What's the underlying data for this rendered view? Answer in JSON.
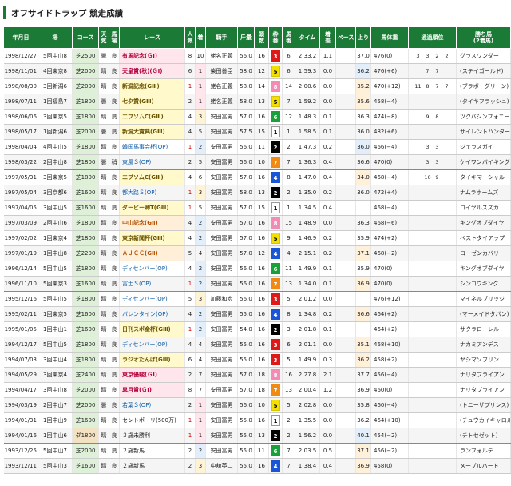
{
  "page": {
    "title": "オフサイドトラップ 競走成績"
  },
  "colors": {
    "header": "#1b7a35"
  },
  "columns": [
    "年月日",
    "場",
    "コース",
    "天気",
    "馬場",
    "レース",
    "人気",
    "着",
    "騎手",
    "斤量",
    "頭数",
    "枠番",
    "馬番",
    "タイム",
    "着差",
    "ペース",
    "上り",
    "馬体重",
    "通過順位",
    "勝ち馬(2着馬)"
  ],
  "rows": [
    {
      "date": "1998/12/27",
      "venue": "5回中山8",
      "course": "芝2500",
      "weather": "曇",
      "track": "良",
      "race": "有馬記念(ＧⅠ)",
      "grade": "g1",
      "pop": "8",
      "finish": "10",
      "jockey": "蛯名正義",
      "weight": "56.0",
      "field": "16",
      "waku": "3",
      "uma": "6",
      "time": "2:33.2",
      "margin": "1.1",
      "pace": "",
      "up": "37.0",
      "up_hl": "",
      "bw": "476(0)",
      "corners": [
        "3",
        "3",
        "2",
        "2"
      ],
      "winner": "グラスワンダー"
    },
    {
      "date": "1998/11/01",
      "venue": "4回東京8",
      "course": "芝2000",
      "weather": "晴",
      "track": "良",
      "race": "天皇賞(秋)(ＧⅠ)",
      "grade": "g1",
      "pop": "6",
      "finish": "1",
      "jockey": "柴田善臣",
      "weight": "58.0",
      "field": "12",
      "waku": "5",
      "uma": "6",
      "time": "1:59.3",
      "margin": "0.0",
      "pace": "",
      "up": "36.2",
      "up_hl": "b",
      "bw": "476(+6)",
      "corners": [
        "",
        "7",
        "7",
        ""
      ],
      "winner": "(ステイゴールド)"
    },
    {
      "date": "1998/08/30",
      "venue": "3回新潟6",
      "course": "芝2000",
      "weather": "晴",
      "track": "良",
      "race": "新潟記念(GⅢ)",
      "grade": "g3",
      "pop": "1",
      "finish": "1",
      "jockey": "蛯名正義",
      "weight": "58.0",
      "field": "14",
      "waku": "8",
      "uma": "14",
      "time": "2:00.6",
      "margin": "0.0",
      "pace": "",
      "up": "35.2",
      "up_hl": "a",
      "bw": "470(+12)",
      "corners": [
        "11",
        "8",
        "7",
        "7"
      ],
      "winner": "(ブラボーグリーン)"
    },
    {
      "date": "1998/07/11",
      "venue": "1回福島7",
      "course": "芝1800",
      "weather": "曇",
      "track": "良",
      "race": "七夕賞(GⅢ)",
      "grade": "g3",
      "pop": "2",
      "finish": "1",
      "jockey": "蛯名正義",
      "weight": "58.0",
      "field": "13",
      "waku": "5",
      "uma": "7",
      "time": "1:59.2",
      "margin": "0.0",
      "pace": "",
      "up": "35.6",
      "up_hl": "a",
      "bw": "458(−4)",
      "corners": [
        "",
        "",
        "",
        ""
      ],
      "winner": "(タイキフラッシュ)"
    },
    {
      "date": "1998/06/06",
      "venue": "3回東京5",
      "course": "芝1800",
      "weather": "晴",
      "track": "良",
      "race": "エプソムC(GⅢ)",
      "grade": "g3",
      "pop": "4",
      "finish": "3",
      "jockey": "安田富男",
      "weight": "57.0",
      "field": "16",
      "waku": "6",
      "uma": "12",
      "time": "1:48.3",
      "margin": "0.1",
      "pace": "",
      "up": "36.3",
      "up_hl": "",
      "bw": "474(−8)",
      "corners": [
        "",
        "9",
        "8",
        ""
      ],
      "winner": "ツクバシンフォニー"
    },
    {
      "date": "1998/05/17",
      "venue": "1回新潟6",
      "course": "芝2000",
      "weather": "曇",
      "track": "良",
      "race": "新潟大賞典(GⅢ)",
      "grade": "g3",
      "pop": "4",
      "finish": "5",
      "jockey": "安田富男",
      "weight": "57.5",
      "field": "15",
      "waku": "1",
      "uma": "1",
      "time": "1:58.5",
      "margin": "0.1",
      "pace": "",
      "up": "36.0",
      "up_hl": "",
      "bw": "482(+6)",
      "corners": [
        "",
        "",
        "",
        ""
      ],
      "winner": "サイレントハンター"
    },
    {
      "date": "1998/04/04",
      "venue": "4回中山5",
      "course": "芝1800",
      "weather": "晴",
      "track": "良",
      "race": "韓国馬事会杯(OP)",
      "grade": "op",
      "pop": "1",
      "finish": "2",
      "jockey": "安田富男",
      "weight": "56.0",
      "field": "11",
      "waku": "2",
      "uma": "2",
      "time": "1:47.3",
      "margin": "0.2",
      "pace": "",
      "up": "36.0",
      "up_hl": "b",
      "bw": "466(−4)",
      "corners": [
        "",
        "3",
        "3",
        ""
      ],
      "winner": "ジェラスガイ"
    },
    {
      "date": "1998/03/22",
      "venue": "2回中山8",
      "course": "芝1800",
      "weather": "曇",
      "track": "稍",
      "race": "東風Ｓ(OP)",
      "grade": "op",
      "pop": "2",
      "finish": "5",
      "jockey": "安田富男",
      "weight": "56.0",
      "field": "10",
      "waku": "7",
      "uma": "7",
      "time": "1:36.3",
      "margin": "0.4",
      "pace": "",
      "up": "36.6",
      "up_hl": "",
      "bw": "470(0)",
      "corners": [
        "",
        "3",
        "3",
        ""
      ],
      "winner": "ケイワンバイキング"
    },
    {
      "date": "1997/05/31",
      "venue": "3回東京5",
      "course": "芝1800",
      "weather": "晴",
      "track": "良",
      "race": "エプソムC(GⅢ)",
      "grade": "g3",
      "pop": "4",
      "finish": "6",
      "jockey": "安田富男",
      "weight": "57.0",
      "field": "16",
      "waku": "4",
      "uma": "8",
      "time": "1:47.0",
      "margin": "0.4",
      "pace": "",
      "up": "34.0",
      "up_hl": "a",
      "bw": "468(−4)",
      "corners": [
        "",
        "10",
        "9",
        ""
      ],
      "winner": "タイキマーシャル"
    },
    {
      "date": "1997/05/04",
      "venue": "3回京都6",
      "course": "芝1600",
      "weather": "晴",
      "track": "良",
      "race": "都大路Ｓ(OP)",
      "grade": "op",
      "pop": "1",
      "finish": "3",
      "jockey": "安田富男",
      "weight": "58.0",
      "field": "13",
      "waku": "2",
      "uma": "2",
      "time": "1:35.0",
      "margin": "0.2",
      "pace": "",
      "up": "36.0",
      "up_hl": "",
      "bw": "472(+4)",
      "corners": [
        "",
        "",
        "",
        ""
      ],
      "winner": "ナムラホームズ"
    },
    {
      "date": "1997/04/05",
      "venue": "3回中山5",
      "course": "芝1600",
      "weather": "晴",
      "track": "良",
      "race": "ダービー卿T(GⅢ)",
      "grade": "g3",
      "pop": "1",
      "finish": "5",
      "jockey": "安田富男",
      "weight": "57.0",
      "field": "15",
      "waku": "1",
      "uma": "1",
      "time": "1:34.5",
      "margin": "0.4",
      "pace": "",
      "up": "",
      "up_hl": "",
      "bw": "468(−4)",
      "corners": [
        "",
        "",
        "",
        ""
      ],
      "winner": "ロイヤルスズカ"
    },
    {
      "date": "1997/03/09",
      "venue": "2回中山6",
      "course": "芝1800",
      "weather": "晴",
      "track": "良",
      "race": "中山記念(GⅡ)",
      "grade": "g2",
      "pop": "4",
      "finish": "2",
      "jockey": "安田富男",
      "weight": "57.0",
      "field": "16",
      "waku": "8",
      "uma": "15",
      "time": "1:48.9",
      "margin": "0.0",
      "pace": "",
      "up": "36.3",
      "up_hl": "",
      "bw": "468(−6)",
      "corners": [
        "",
        "",
        "",
        ""
      ],
      "winner": "キングオブダイヤ"
    },
    {
      "date": "1997/02/02",
      "venue": "1回東京4",
      "course": "芝1800",
      "weather": "晴",
      "track": "良",
      "race": "東京新聞杯(GⅢ)",
      "grade": "g3",
      "pop": "4",
      "finish": "2",
      "jockey": "安田富男",
      "weight": "57.0",
      "field": "16",
      "waku": "5",
      "uma": "9",
      "time": "1:46.9",
      "margin": "0.2",
      "pace": "",
      "up": "35.9",
      "up_hl": "",
      "bw": "474(+2)",
      "corners": [
        "",
        "",
        "",
        ""
      ],
      "winner": "ベストタイアップ"
    },
    {
      "date": "1997/01/19",
      "venue": "1回中山8",
      "course": "芝2200",
      "weather": "晴",
      "track": "良",
      "race": "ＡＪＣＣ(GⅡ)",
      "grade": "g2",
      "pop": "5",
      "finish": "4",
      "jockey": "安田富男",
      "weight": "57.0",
      "field": "12",
      "waku": "4",
      "uma": "4",
      "time": "2:15.1",
      "margin": "0.2",
      "pace": "",
      "up": "37.1",
      "up_hl": "a",
      "bw": "468(−2)",
      "corners": [
        "",
        "",
        "",
        ""
      ],
      "winner": "ローゼンカバリー"
    },
    {
      "date": "1996/12/14",
      "venue": "5回中山5",
      "course": "芝1800",
      "weather": "晴",
      "track": "良",
      "race": "ディセンバー(OP)",
      "grade": "op",
      "pop": "4",
      "finish": "2",
      "jockey": "安田富男",
      "weight": "56.0",
      "field": "16",
      "waku": "6",
      "uma": "11",
      "time": "1:49.9",
      "margin": "0.1",
      "pace": "",
      "up": "35.9",
      "up_hl": "",
      "bw": "470(0)",
      "corners": [
        "",
        "",
        "",
        ""
      ],
      "winner": "キングオブダイヤ"
    },
    {
      "date": "1996/11/10",
      "venue": "5回東京3",
      "course": "芝1600",
      "weather": "晴",
      "track": "良",
      "race": "富士Ｓ(OP)",
      "grade": "op",
      "pop": "1",
      "finish": "2",
      "jockey": "安田富男",
      "weight": "56.0",
      "field": "16",
      "waku": "7",
      "uma": "13",
      "time": "1:34.0",
      "margin": "0.1",
      "pace": "",
      "up": "36.9",
      "up_hl": "a",
      "bw": "470(0)",
      "corners": [
        "",
        "",
        "",
        ""
      ],
      "winner": "シンコウキング"
    },
    {
      "date": "1995/12/16",
      "venue": "5回中山5",
      "course": "芝1800",
      "weather": "晴",
      "track": "良",
      "race": "ディセンバー(OP)",
      "grade": "op",
      "pop": "5",
      "finish": "3",
      "jockey": "加藤和宏",
      "weight": "56.0",
      "field": "16",
      "waku": "3",
      "uma": "5",
      "time": "2:01.2",
      "margin": "0.0",
      "pace": "",
      "up": "",
      "up_hl": "",
      "bw": "476(+12)",
      "corners": [
        "",
        "",
        "",
        ""
      ],
      "winner": "マイネルブリッジ"
    },
    {
      "date": "1995/02/11",
      "venue": "1回東京5",
      "course": "芝1600",
      "weather": "晴",
      "track": "良",
      "race": "バレンタイン(OP)",
      "grade": "op",
      "pop": "4",
      "finish": "2",
      "jockey": "安田富男",
      "weight": "55.0",
      "field": "16",
      "waku": "4",
      "uma": "8",
      "time": "1:34.8",
      "margin": "0.2",
      "pace": "",
      "up": "36.6",
      "up_hl": "a",
      "bw": "464(+2)",
      "corners": [
        "",
        "",
        "",
        ""
      ],
      "winner": "(マーメイドタバン)"
    },
    {
      "date": "1995/01/05",
      "venue": "1回中山1",
      "course": "芝1600",
      "weather": "晴",
      "track": "良",
      "race": "日刊スポ金杯(GⅢ)",
      "grade": "g3",
      "pop": "1",
      "finish": "2",
      "jockey": "安田富男",
      "weight": "54.0",
      "field": "16",
      "waku": "2",
      "uma": "3",
      "time": "2:01.8",
      "margin": "0.1",
      "pace": "",
      "up": "",
      "up_hl": "",
      "bw": "464(+2)",
      "corners": [
        "",
        "",
        "",
        ""
      ],
      "winner": "サクラローレル"
    },
    {
      "date": "1994/12/17",
      "venue": "5回中山5",
      "course": "芝1800",
      "weather": "晴",
      "track": "良",
      "race": "ディセンバー(OP)",
      "grade": "op",
      "pop": "4",
      "finish": "4",
      "jockey": "安田富男",
      "weight": "55.0",
      "field": "16",
      "waku": "3",
      "uma": "6",
      "time": "2:01.1",
      "margin": "0.0",
      "pace": "",
      "up": "35.1",
      "up_hl": "a",
      "bw": "468(+10)",
      "corners": [
        "",
        "",
        "",
        ""
      ],
      "winner": "ナカミアンデス"
    },
    {
      "date": "1994/07/03",
      "venue": "3回中山4",
      "course": "芝1800",
      "weather": "晴",
      "track": "良",
      "race": "ラジオたんぱ(GⅢ)",
      "grade": "g3",
      "pop": "6",
      "finish": "4",
      "jockey": "安田富男",
      "weight": "55.0",
      "field": "16",
      "waku": "3",
      "uma": "5",
      "time": "1:49.9",
      "margin": "0.3",
      "pace": "",
      "up": "36.2",
      "up_hl": "a",
      "bw": "458(+2)",
      "corners": [
        "",
        "",
        "",
        ""
      ],
      "winner": "ヤシマソブリン"
    },
    {
      "date": "1994/05/29",
      "venue": "3回東京4",
      "course": "芝2400",
      "weather": "晴",
      "track": "良",
      "race": "東京優駿(ＧⅠ)",
      "grade": "g1",
      "pop": "2",
      "finish": "7",
      "jockey": "安田富男",
      "weight": "57.0",
      "field": "18",
      "waku": "8",
      "uma": "16",
      "time": "2:27.8",
      "margin": "2.1",
      "pace": "",
      "up": "37.7",
      "up_hl": "",
      "bw": "456(−4)",
      "corners": [
        "",
        "",
        "",
        ""
      ],
      "winner": "ナリタブライアン"
    },
    {
      "date": "1994/04/17",
      "venue": "3回中山8",
      "course": "芝2000",
      "weather": "晴",
      "track": "良",
      "race": "皐月賞(ＧⅠ)",
      "grade": "g1",
      "pop": "8",
      "finish": "7",
      "jockey": "安田富男",
      "weight": "57.0",
      "field": "18",
      "waku": "7",
      "uma": "13",
      "time": "2:00.4",
      "margin": "1.2",
      "pace": "",
      "up": "36.9",
      "up_hl": "",
      "bw": "460(0)",
      "corners": [
        "",
        "",
        "",
        ""
      ],
      "winner": "ナリタブライアン"
    },
    {
      "date": "1994/03/19",
      "venue": "2回中山7",
      "course": "芝2000",
      "weather": "曇",
      "track": "良",
      "race": "若葉Ｓ(OP)",
      "grade": "op",
      "pop": "2",
      "finish": "1",
      "jockey": "安田富男",
      "weight": "56.0",
      "field": "10",
      "waku": "5",
      "uma": "5",
      "time": "2:02.8",
      "margin": "0.0",
      "pace": "",
      "up": "35.8",
      "up_hl": "",
      "bw": "460(−4)",
      "corners": [
        "",
        "",
        "",
        ""
      ],
      "winner": "(トニーザプリンス)"
    },
    {
      "date": "1994/01/31",
      "venue": "1回中山9",
      "course": "芝1600",
      "weather": "晴",
      "track": "良",
      "race": "セントポーリ(500万)",
      "grade": "",
      "pop": "1",
      "finish": "1",
      "jockey": "安田富男",
      "weight": "55.0",
      "field": "16",
      "waku": "1",
      "uma": "2",
      "time": "1:35.5",
      "margin": "0.0",
      "pace": "",
      "up": "36.2",
      "up_hl": "",
      "bw": "464(+10)",
      "corners": [
        "",
        "",
        "",
        ""
      ],
      "winner": "(チュウカイキャロル)"
    },
    {
      "date": "1994/01/16",
      "venue": "1回中山6",
      "course": "ダ1800",
      "weather": "晴",
      "track": "良",
      "race": "３歳未勝利",
      "grade": "",
      "pop": "1",
      "finish": "1",
      "jockey": "安田富男",
      "weight": "55.0",
      "field": "13",
      "waku": "2",
      "uma": "2",
      "time": "1:56.2",
      "margin": "0.0",
      "pace": "",
      "up": "40.1",
      "up_hl": "b",
      "bw": "454(−2)",
      "corners": [
        "",
        "",
        "",
        ""
      ],
      "winner": "(チトセゼット)"
    },
    {
      "date": "1993/12/25",
      "venue": "5回中山7",
      "course": "芝2000",
      "weather": "晴",
      "track": "良",
      "race": "２歳新馬",
      "grade": "",
      "pop": "2",
      "finish": "2",
      "jockey": "安田富男",
      "weight": "55.0",
      "field": "11",
      "waku": "6",
      "uma": "7",
      "time": "2:03.5",
      "margin": "0.5",
      "pace": "",
      "up": "37.1",
      "up_hl": "a",
      "bw": "456(−2)",
      "corners": [
        "",
        "",
        "",
        ""
      ],
      "winner": "ランフォルテ"
    },
    {
      "date": "1993/12/11",
      "venue": "5回中山3",
      "course": "芝1600",
      "weather": "晴",
      "track": "良",
      "race": "２歳新馬",
      "grade": "",
      "pop": "2",
      "finish": "3",
      "jockey": "中舘英二",
      "weight": "55.0",
      "field": "16",
      "waku": "4",
      "uma": "7",
      "time": "1:38.4",
      "margin": "0.4",
      "pace": "",
      "up": "36.9",
      "up_hl": "a",
      "bw": "458(0)",
      "corners": [
        "",
        "",
        "",
        ""
      ],
      "winner": "メープルハート"
    }
  ]
}
